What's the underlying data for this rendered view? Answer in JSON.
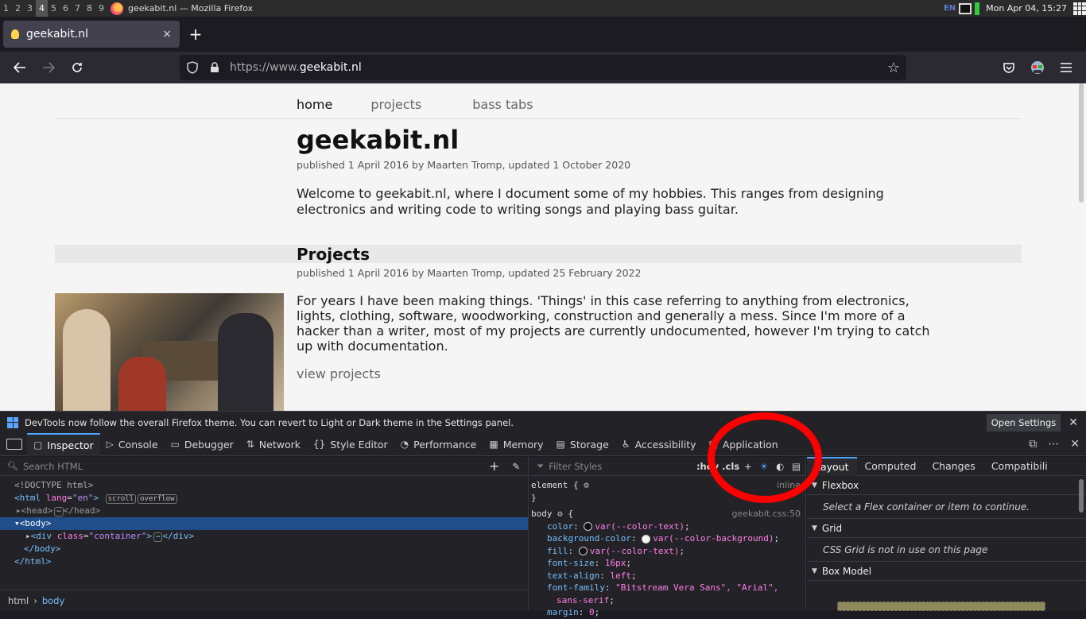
{
  "os_bar": {
    "workspaces": [
      "1",
      "2",
      "3",
      "4",
      "5",
      "6",
      "7",
      "8",
      "9"
    ],
    "active_workspace": "4",
    "window_title": "geekabit.nl — Mozilla Firefox",
    "lang": "EN",
    "clock": "Mon Apr 04, 15:27"
  },
  "browser": {
    "tab_title": "geekabit.nl",
    "tab_close": "×",
    "new_tab": "+",
    "url_scheme": "https://www.",
    "url_host": "geekabit.nl"
  },
  "page": {
    "menu": [
      "home",
      "projects",
      "bass tabs"
    ],
    "title": "geekabit.nl",
    "meta": "published 1 April 2016 by Maarten Tromp, updated 1 October 2020",
    "intro": "Welcome to geekabit.nl, where I document some of my hobbies. This ranges from designing electronics and writing code to writing songs and playing bass guitar.",
    "section_title": "Projects",
    "section_meta": "published 1 April 2016 by Maarten Tromp, updated 25 February 2022",
    "section_text": "For years I have been making things. 'Things' in this case referring to anything from electronics, lights, clothing, software, woodworking, construction and generally a mess. Since I'm more of a hacker than a writer, most of my projects are currently undocumented, however I'm trying to catch up with documentation.",
    "view_link": "view projects"
  },
  "devtools": {
    "notice": "DevTools now follow the overall Firefox theme. You can revert to Light or Dark theme in the Settings panel.",
    "open_settings": "Open Settings",
    "tabs": [
      "Inspector",
      "Console",
      "Debugger",
      "Network",
      "Style Editor",
      "Performance",
      "Memory",
      "Storage",
      "Accessibility",
      "Application"
    ],
    "search_placeholder": "Search HTML",
    "filter_placeholder": "Filter Styles",
    "hov_cls": ":hov .cls",
    "tree": {
      "doctype": "<!DOCTYPE html>",
      "html_open": "<html",
      "lang_attr": "lang",
      "lang_val": "\"en\"",
      "scroll_badge": "scroll",
      "overflow_badge": "overflow",
      "head": "<head>",
      "head_close": "</head>",
      "body_open": "<body>",
      "div_open": "<div",
      "class_attr": "class",
      "class_val": "\"container\"",
      "div_close": "</div>",
      "body_close": "</body>",
      "html_close": "</html>"
    },
    "breadcrumbs": [
      "html",
      "body"
    ],
    "rules": {
      "element": "element {",
      "element_close": "}",
      "inline": "inline",
      "body_sel": "body",
      "body_open": "{",
      "source": "geekabit.css:50",
      "decl1_prop": "color",
      "decl1_val": "var(--color-text)",
      "decl2_prop": "background-color",
      "decl2_val": "var(--color-background)",
      "decl3_prop": "fill",
      "decl3_val": "var(--color-text)",
      "decl4_prop": "font-size",
      "decl4_val": "16px",
      "decl5_prop": "text-align",
      "decl5_val": "left",
      "decl6_prop": "font-family",
      "decl6_val": "\"Bitstream Vera Sans\", \"Arial\",",
      "decl6_cont": "sans-serif",
      "decl7_prop": "margin",
      "decl7_val": "0"
    },
    "side_tabs": [
      "Layout",
      "Computed",
      "Changes",
      "Compatibili"
    ],
    "flexbox": "Flexbox",
    "flexbox_msg": "Select a Flex container or item to continue.",
    "grid": "Grid",
    "grid_msg": "CSS Grid is not in use on this page",
    "boxmodel": "Box Model"
  },
  "colors": {
    "annotation_circle": "#ff0000",
    "accent": "#4da6ff"
  }
}
